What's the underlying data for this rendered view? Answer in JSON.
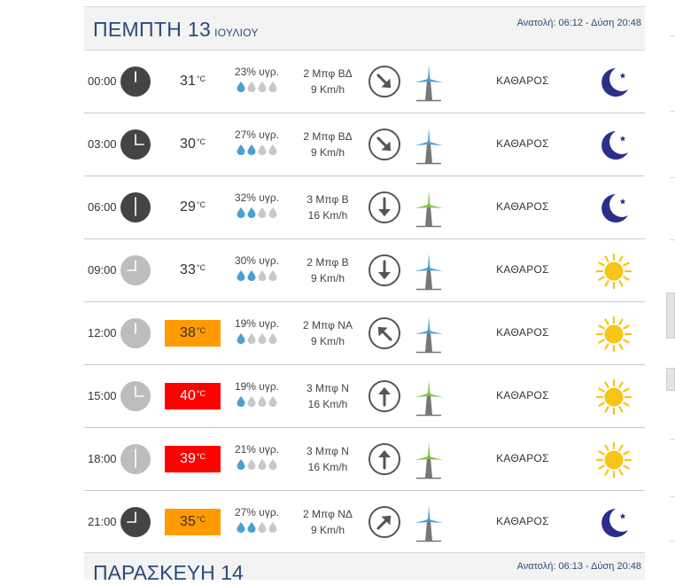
{
  "day": {
    "title": "ΠΕΜΠΤΗ 13",
    "month": "ΙΟΥΛΙΟΥ",
    "sun_times": "Ανατολή: 06:12  - Δύση 20:48"
  },
  "rows": [
    {
      "time": "00:00",
      "temp": "31",
      "unit": "°C",
      "humidity": "23% υγρ.",
      "drops": 1,
      "wind_force": "2 Μπφ ΒΔ",
      "wind_speed": "9 Km/h",
      "wind_dir": "arrow-down-right-icon",
      "mill_color": "#4a9fd4",
      "condition": "ΚΑΘΑΡΟΣ",
      "icon": "moon-icon",
      "temp_level": "normal",
      "clock_dark": true
    },
    {
      "time": "03:00",
      "temp": "30",
      "unit": "°C",
      "humidity": "27% υγρ.",
      "drops": 2,
      "wind_force": "2 Μπφ ΒΔ",
      "wind_speed": "9 Km/h",
      "wind_dir": "arrow-down-right-icon",
      "mill_color": "#4a9fd4",
      "condition": "ΚΑΘΑΡΟΣ",
      "icon": "moon-icon",
      "temp_level": "normal",
      "clock_dark": true
    },
    {
      "time": "06:00",
      "temp": "29",
      "unit": "°C",
      "humidity": "32% υγρ.",
      "drops": 2,
      "wind_force": "3 Μπφ Β",
      "wind_speed": "16 Km/h",
      "wind_dir": "arrow-down-icon",
      "mill_color": "#7cc142",
      "condition": "ΚΑΘΑΡΟΣ",
      "icon": "moon-icon",
      "temp_level": "normal",
      "clock_dark": true
    },
    {
      "time": "09:00",
      "temp": "33",
      "unit": "°C",
      "humidity": "30% υγρ.",
      "drops": 2,
      "wind_force": "2 Μπφ Β",
      "wind_speed": "9 Km/h",
      "wind_dir": "arrow-down-icon",
      "mill_color": "#4a9fd4",
      "condition": "ΚΑΘΑΡΟΣ",
      "icon": "sun-icon",
      "temp_level": "normal",
      "clock_dark": false
    },
    {
      "time": "12:00",
      "temp": "38",
      "unit": "°C",
      "humidity": "19% υγρ.",
      "drops": 1,
      "wind_force": "2 Μπφ ΝΑ",
      "wind_speed": "9 Km/h",
      "wind_dir": "arrow-up-left-icon",
      "mill_color": "#4a9fd4",
      "condition": "ΚΑΘΑΡΟΣ",
      "icon": "sun-icon",
      "temp_level": "hot",
      "clock_dark": false
    },
    {
      "time": "15:00",
      "temp": "40",
      "unit": "°C",
      "humidity": "19% υγρ.",
      "drops": 1,
      "wind_force": "3 Μπφ Ν",
      "wind_speed": "16 Km/h",
      "wind_dir": "arrow-up-icon",
      "mill_color": "#7cc142",
      "condition": "ΚΑΘΑΡΟΣ",
      "icon": "sun-icon",
      "temp_level": "veryhot",
      "clock_dark": false
    },
    {
      "time": "18:00",
      "temp": "39",
      "unit": "°C",
      "humidity": "21% υγρ.",
      "drops": 1,
      "wind_force": "3 Μπφ Ν",
      "wind_speed": "16 Km/h",
      "wind_dir": "arrow-up-icon",
      "mill_color": "#7cc142",
      "condition": "ΚΑΘΑΡΟΣ",
      "icon": "sun-icon",
      "temp_level": "veryhot",
      "clock_dark": false
    },
    {
      "time": "21:00",
      "temp": "35",
      "unit": "°C",
      "humidity": "27% υγρ.",
      "drops": 2,
      "wind_force": "2 Μπφ ΝΔ",
      "wind_speed": "9 Km/h",
      "wind_dir": "arrow-up-right-icon",
      "mill_color": "#4a9fd4",
      "condition": "ΚΑΘΑΡΟΣ",
      "icon": "moon-icon",
      "temp_level": "hot",
      "clock_dark": true
    }
  ],
  "next_day": {
    "title": "ΠΑΡΑΣΚΕΥΗ 14",
    "sun_times": "Ανατολή: 06:13  - Δύση 20:48"
  },
  "colors": {
    "hot": "#ff9a00",
    "veryhot": "#ff0000",
    "moon": "#2a2f8a",
    "sun": "#f5c518",
    "drop_filled": "#4a9fd4",
    "drop_empty": "#c8c8c8"
  }
}
